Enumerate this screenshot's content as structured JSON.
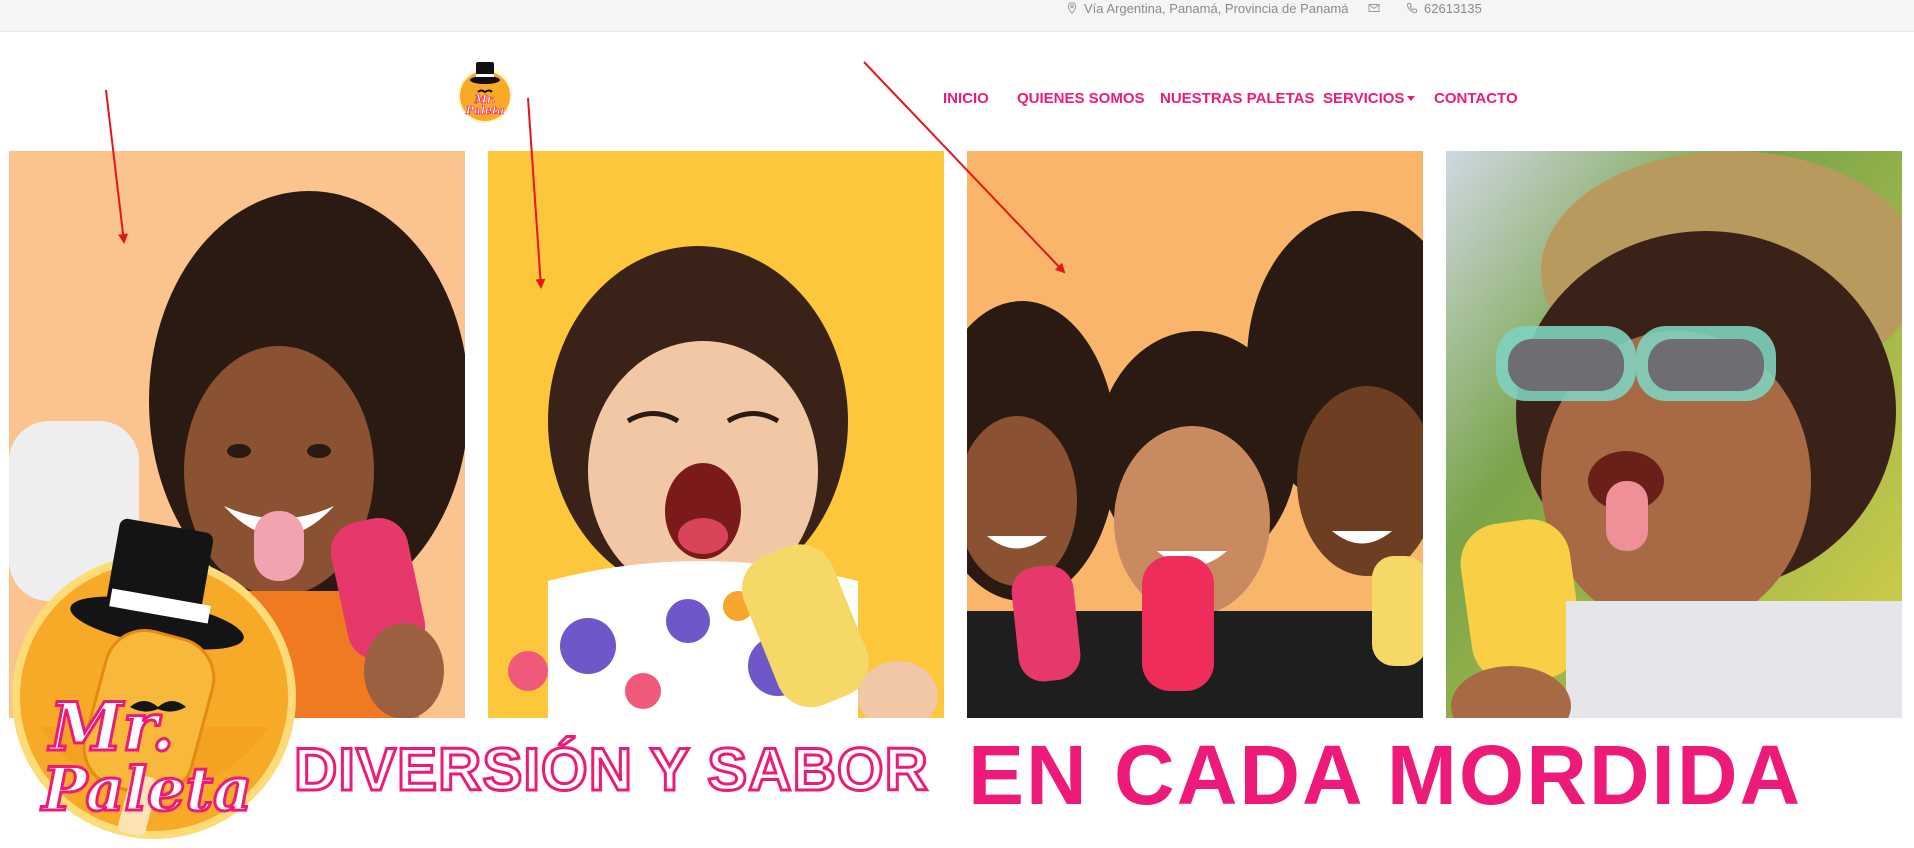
{
  "topbar": {
    "address": "Vía Argentina, Panamá, Provincia de Panamá",
    "phone": "62613135",
    "icons": [
      "location-pin-icon",
      "envelope-icon",
      "phone-icon"
    ]
  },
  "header": {
    "logo_text_line1": "Mr.",
    "logo_text_line2": "Paleta",
    "nav": [
      {
        "label": "INICIO"
      },
      {
        "label": "QUIENES SOMOS"
      },
      {
        "label": "NUESTRAS PALETAS"
      },
      {
        "label": "SERVICIOS",
        "has_dropdown": true
      },
      {
        "label": "CONTACTO"
      }
    ]
  },
  "gallery": [
    {
      "alt": "Woman with curly hair licking a pink popsicle",
      "background": "#fbc48e"
    },
    {
      "alt": "Toddler laughing holding a yellow popsicle",
      "background": "#fcc73a"
    },
    {
      "alt": "Three women laughing with red popsicles",
      "background": "#f9b66b"
    },
    {
      "alt": "Child in sunglasses and straw hat licking a yellow popsicle",
      "background": "#a9c45c"
    }
  ],
  "banner": {
    "slogan_part1": "DIVERSIÓN Y SABOR",
    "slogan_part2": "EN CADA MORDIDA"
  },
  "colors": {
    "brand_pink": "#ee1a79",
    "brand_orange": "#f7a928",
    "annotation_red": "#e8141a"
  }
}
